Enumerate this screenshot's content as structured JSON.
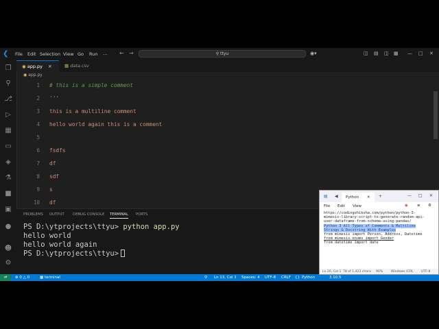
{
  "window": {
    "menu": [
      "File",
      "Edit",
      "Selection",
      "View",
      "Go",
      "Run"
    ],
    "search_text": "ttyu"
  },
  "tabs": [
    {
      "label": "app.py",
      "active": true
    },
    {
      "label": "data.csv",
      "active": false
    }
  ],
  "breadcrumb": "app.py",
  "editor": {
    "lines": [
      {
        "num": "1",
        "text": "# this is a simple comment",
        "kind": "comment"
      },
      {
        "num": "2",
        "text": "'''",
        "kind": "string"
      },
      {
        "num": "3",
        "text": "this is a multiline comment",
        "kind": "string"
      },
      {
        "num": "4",
        "text": "hello world again this is a comment",
        "kind": "string"
      },
      {
        "num": "5",
        "text": "",
        "kind": "string"
      },
      {
        "num": "6",
        "text": "fsdfs",
        "kind": "string"
      },
      {
        "num": "7",
        "text": "df",
        "kind": "string"
      },
      {
        "num": "8",
        "text": "sdf",
        "kind": "string"
      },
      {
        "num": "9",
        "text": "s",
        "kind": "string"
      },
      {
        "num": "10",
        "text": "df",
        "kind": "string"
      }
    ]
  },
  "panel": {
    "tabs": [
      "PROBLEMS",
      "OUTPUT",
      "DEBUG CONSOLE",
      "TERMINAL",
      "PORTS"
    ],
    "active_tab": "TERMINAL",
    "terminal": {
      "prompt": "PS D:\\ytprojects\\ttyu>",
      "command": "python app.py",
      "output": [
        "hello world",
        "hello world again"
      ]
    }
  },
  "statusbar": {
    "errors": "0",
    "warnings": "0",
    "terminal": "terminal",
    "position": "Ln 13, Col 1",
    "spaces": "Spaces: 4",
    "encoding": "UTF-8",
    "eol": "CRLF",
    "language": "Python",
    "version": "3.10.5",
    "golive": "Go Live",
    "prettier": "Prettier"
  },
  "notepad": {
    "tab": "Python",
    "menu": [
      "File",
      "Edit",
      "View"
    ],
    "lines": [
      {
        "text": "https://codingshiksha.com/python/python-3-",
        "sel": false,
        "u": false
      },
      {
        "text": "mimesis-library-script-to-generate-random-api-",
        "sel": false,
        "u": false
      },
      {
        "text": "user-dataframe-from-schema-using-pandas/",
        "sel": false,
        "u": false
      },
      {
        "text": "",
        "sel": false,
        "u": false
      },
      {
        "text": "Python 3 All Types of Comments & Multiline",
        "sel": true,
        "u": false
      },
      {
        "text": "Strings & Docstring With Examples",
        "sel": true,
        "u": false
      },
      {
        "text": "",
        "sel": false,
        "u": false
      },
      {
        "text": "",
        "sel": false,
        "u": false
      },
      {
        "text": "",
        "sel": false,
        "u": false
      },
      {
        "text": "from mimesis import Person, Address, Datetime",
        "sel": false,
        "u": false
      },
      {
        "text": "from mimesis.enums import Gender",
        "sel": false,
        "u": true
      },
      {
        "text": "from datetime import date",
        "sel": false,
        "u": false
      }
    ],
    "status": {
      "position": "Ln 20, Col 1",
      "chars": "78 of 1,423 chara",
      "zoom": "90%",
      "eol": "Windows (CRL",
      "encoding": "UTF-8"
    }
  }
}
